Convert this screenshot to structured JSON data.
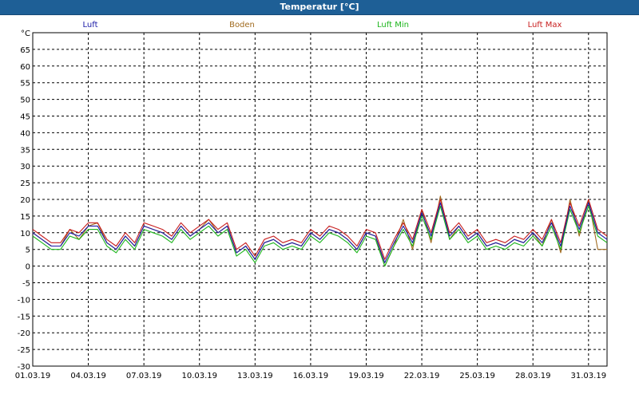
{
  "window": {
    "title": "Temperatur [°C]"
  },
  "chart_data": {
    "type": "line",
    "title": "Temperatur [°C]",
    "ylabel": "°C",
    "ylim": [
      -30,
      70
    ],
    "yticks": [
      65,
      60,
      55,
      50,
      45,
      40,
      35,
      30,
      25,
      20,
      15,
      10,
      5,
      0,
      -5,
      -10,
      -15,
      -20,
      -25,
      -30
    ],
    "xlim": [
      "01.03.19",
      "01.04.19"
    ],
    "xtick_labels": [
      "01.03.19",
      "04.03.19",
      "07.03.19",
      "10.03.19",
      "13.03.19",
      "16.03.19",
      "19.03.19",
      "22.03.19",
      "25.03.19",
      "28.03.19",
      "31.03.19"
    ],
    "grid": true,
    "legend_position": "top",
    "legend": [
      "Luft",
      "Boden",
      "Luft Min",
      "Luft Max"
    ],
    "x": [
      "01.03.19 00:00",
      "01.03.19 12:00",
      "02.03.19 00:00",
      "02.03.19 12:00",
      "03.03.19 00:00",
      "03.03.19 12:00",
      "04.03.19 00:00",
      "04.03.19 12:00",
      "05.03.19 00:00",
      "05.03.19 12:00",
      "06.03.19 00:00",
      "06.03.19 12:00",
      "07.03.19 00:00",
      "07.03.19 12:00",
      "08.03.19 00:00",
      "08.03.19 12:00",
      "09.03.19 00:00",
      "09.03.19 12:00",
      "10.03.19 00:00",
      "10.03.19 12:00",
      "11.03.19 00:00",
      "11.03.19 12:00",
      "12.03.19 00:00",
      "12.03.19 12:00",
      "13.03.19 00:00",
      "13.03.19 12:00",
      "14.03.19 00:00",
      "14.03.19 12:00",
      "15.03.19 00:00",
      "15.03.19 12:00",
      "16.03.19 00:00",
      "16.03.19 12:00",
      "17.03.19 00:00",
      "17.03.19 12:00",
      "18.03.19 00:00",
      "18.03.19 12:00",
      "19.03.19 00:00",
      "19.03.19 12:00",
      "20.03.19 00:00",
      "20.03.19 12:00",
      "21.03.19 00:00",
      "21.03.19 12:00",
      "22.03.19 00:00",
      "22.03.19 12:00",
      "23.03.19 00:00",
      "23.03.19 12:00",
      "24.03.19 00:00",
      "24.03.19 12:00",
      "25.03.19 00:00",
      "25.03.19 12:00",
      "26.03.19 00:00",
      "26.03.19 12:00",
      "27.03.19 00:00",
      "27.03.19 12:00",
      "28.03.19 00:00",
      "28.03.19 12:00",
      "29.03.19 00:00",
      "29.03.19 12:00",
      "30.03.19 00:00",
      "30.03.19 12:00",
      "31.03.19 00:00",
      "31.03.19 12:00",
      "01.04.19 00:00"
    ],
    "series": [
      {
        "name": "Luft",
        "color": "#1a1aa6",
        "values": [
          10,
          8,
          6,
          6,
          10,
          9,
          12,
          12,
          7,
          5,
          9,
          6,
          12,
          11,
          10,
          8,
          12,
          9,
          11,
          13,
          10,
          12,
          4,
          6,
          2,
          7,
          8,
          6,
          7,
          6,
          10,
          8,
          11,
          10,
          8,
          5,
          10,
          9,
          1,
          7,
          12,
          7,
          16,
          9,
          19,
          9,
          12,
          8,
          10,
          6,
          7,
          6,
          8,
          7,
          10,
          7,
          13,
          6,
          18,
          11,
          19,
          10,
          8
        ]
      },
      {
        "name": "Boden",
        "color": "#a06a1e",
        "values": [
          10,
          8,
          6,
          6,
          11,
          8,
          12,
          13,
          7,
          5,
          9,
          6,
          12,
          11,
          10,
          8,
          12,
          9,
          11,
          14,
          10,
          12,
          4,
          6,
          2,
          7,
          8,
          6,
          7,
          6,
          10,
          8,
          11,
          10,
          8,
          5,
          10,
          9,
          0,
          6,
          14,
          5,
          17,
          7,
          21,
          8,
          12,
          8,
          10,
          6,
          7,
          6,
          8,
          7,
          10,
          6,
          14,
          4,
          20,
          9,
          20,
          5,
          5
        ]
      },
      {
        "name": "Luft Min",
        "color": "#1cb51c",
        "values": [
          9,
          7,
          5,
          5,
          9,
          8,
          11,
          11,
          6,
          4,
          8,
          5,
          11,
          10,
          9,
          7,
          11,
          8,
          10,
          12,
          9,
          11,
          3,
          5,
          1,
          6,
          7,
          5,
          6,
          5,
          9,
          7,
          10,
          9,
          7,
          4,
          9,
          8,
          0,
          6,
          11,
          6,
          15,
          8,
          18,
          8,
          11,
          7,
          9,
          5,
          6,
          5,
          7,
          6,
          9,
          6,
          12,
          5,
          17,
          10,
          18,
          9,
          7
        ]
      },
      {
        "name": "Luft Max",
        "color": "#c81e1e",
        "values": [
          11,
          9,
          7,
          7,
          11,
          10,
          13,
          13,
          8,
          6,
          10,
          7,
          13,
          12,
          11,
          9,
          13,
          10,
          12,
          14,
          11,
          13,
          5,
          7,
          3,
          8,
          9,
          7,
          8,
          7,
          11,
          9,
          12,
          11,
          9,
          6,
          11,
          10,
          2,
          8,
          13,
          8,
          17,
          10,
          20,
          10,
          13,
          9,
          11,
          7,
          8,
          7,
          9,
          8,
          11,
          8,
          14,
          7,
          19,
          12,
          20,
          11,
          9
        ]
      }
    ]
  }
}
